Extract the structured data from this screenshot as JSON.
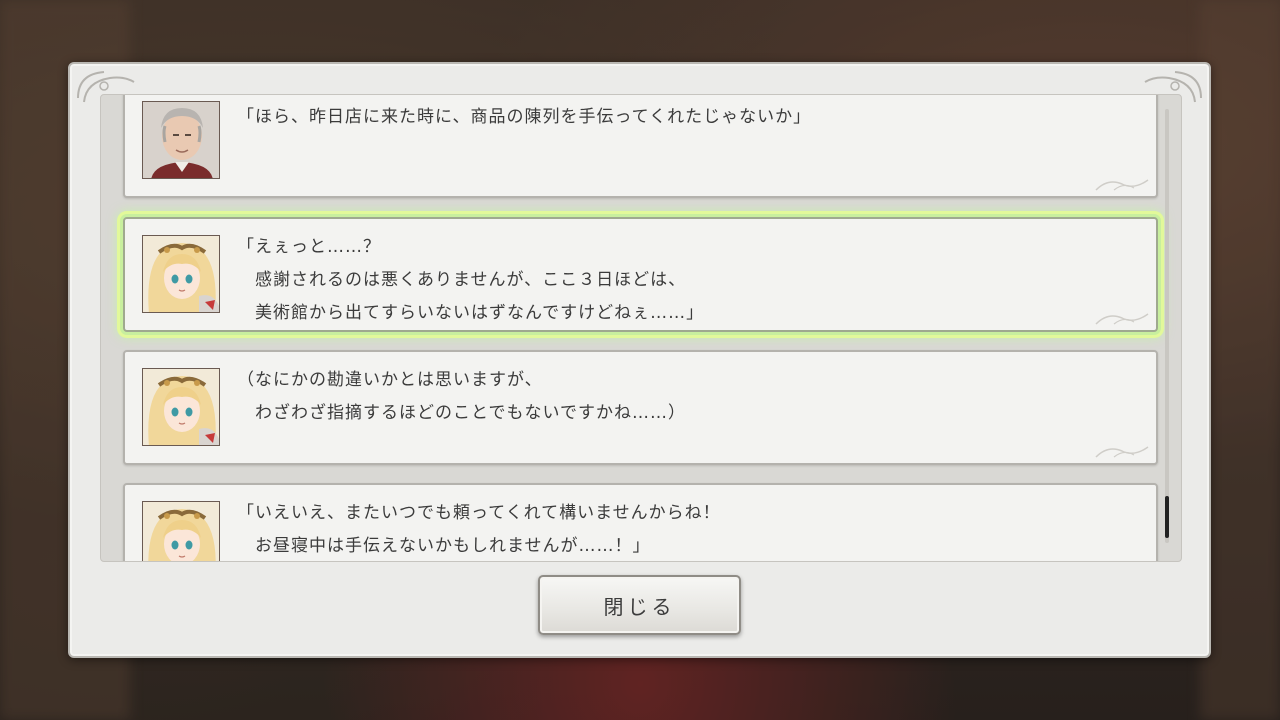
{
  "log": {
    "entries": [
      {
        "speaker_icon": "shopkeeper-portrait",
        "lines": [
          "「ほら、昨日店に来た時に、商品の陳列を手伝ってくれたじゃないか」"
        ]
      },
      {
        "speaker_icon": "heroine-portrait",
        "lines": [
          "「えぇっと……？",
          "　感謝されるのは悪くありませんが、ここ３日ほどは、",
          "　美術館から出てすらいないはずなんですけどねぇ……」"
        ]
      },
      {
        "speaker_icon": "heroine-portrait",
        "lines": [
          "（なにかの勘違いかとは思いますが、",
          "　わざわざ指摘するほどのことでもないですかね……）"
        ]
      },
      {
        "speaker_icon": "heroine-portrait",
        "lines": [
          "「いえいえ、またいつでも頼ってくれて構いませんからね！",
          "　お昼寝中は手伝えないかもしれませんが……！」"
        ]
      }
    ]
  },
  "close_button": {
    "label": "閉じる"
  },
  "colors": {
    "selected_glow": "#c8ef9e",
    "panel": "#ebebe9",
    "text": "#3b3b3b"
  }
}
